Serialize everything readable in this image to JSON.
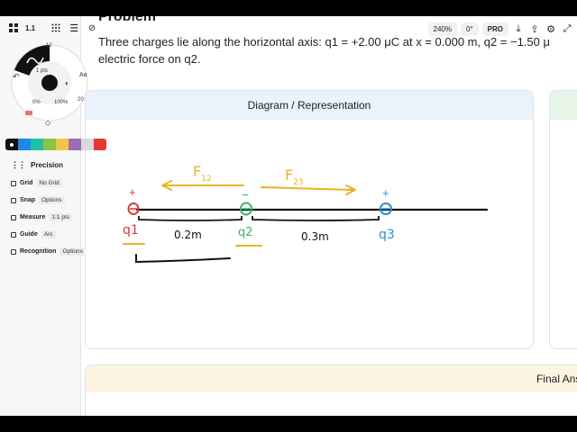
{
  "toolbar": {
    "version": "1.1",
    "zoom": "240%",
    "rotation": "0°",
    "pro_label": "PRO"
  },
  "problem": {
    "title": "Problem",
    "text_line1": "Three charges lie along the horizontal axis: q1 = +2.00 μC at x = 0.000 m, q2 = −1.50 μ",
    "text_line2": "electric force on q2."
  },
  "diagram_card": {
    "title": "Diagram / Representation"
  },
  "final_card": {
    "title": "Final Answ"
  },
  "brush_menu": {
    "size_value": "12",
    "thickness": "1 pts",
    "opacity_left": "0%",
    "opacity_right": "100%",
    "font_label": "Aa",
    "side_label": "20"
  },
  "palette": {
    "colors": [
      "#111111",
      "#1e88e5",
      "#20bfa8",
      "#8bc34a",
      "#f4c542",
      "#9c6bb3",
      "#d9d9d9",
      "#e53935"
    ]
  },
  "precision": {
    "title": "Precision",
    "rows": [
      {
        "label": "Grid",
        "value": "No Grid"
      },
      {
        "label": "Snap",
        "value": "Options"
      },
      {
        "label": "Measure",
        "value": "1:1 pts"
      },
      {
        "label": "Guide",
        "value": "Arc"
      },
      {
        "label": "Recognition",
        "value": "Options"
      }
    ]
  },
  "sketch": {
    "f12": "F12",
    "f23": "F23",
    "plus1": "+",
    "minus2": "−",
    "plus3": "+",
    "q1": "q1",
    "q2": "q2",
    "q3": "q3",
    "d12": "0.2m",
    "d23": "0.3m",
    "colors": {
      "q1": "#d93a3a",
      "q2": "#3ab56a",
      "q3": "#2a8fd6",
      "force": "#e6b422",
      "ink": "#111111"
    }
  }
}
